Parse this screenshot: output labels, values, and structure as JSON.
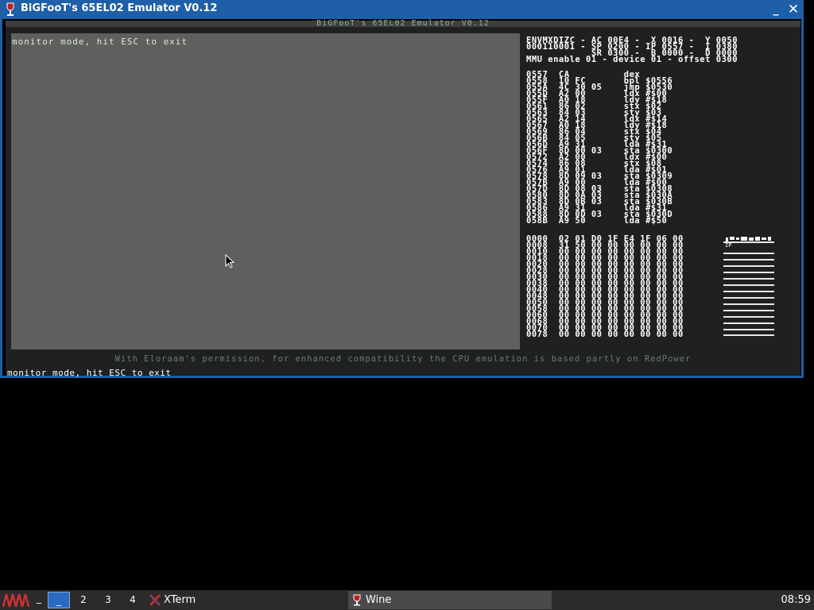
{
  "window": {
    "title": "BiGFooT's 65EL02 Emulator V0.12",
    "minimize_label": "_",
    "close_label": "✕"
  },
  "app": {
    "banner": "BiGFooT's 65EL02 Emulator V0.12",
    "terminal_line": "monitor mode, hit ESC to exit",
    "registers": "ENVMXDIZC - AC 00E4 -  X 0016 -  Y 0050\n000110001 - SP 0200 - IP 0557 -  I 0380\n            SR 0300 -  B 0000 -  D 0000\nMMU enable 01 - device 01 - offset 0300",
    "disassembly": "0557  CA          dex\n0558  10 FC       bpl $0556\n055A  4C 30 05    jmp $0530\n055D  A2 00       ldx #$00\n055F  A0 18       ldy #$18\n0561  86 02       stx $02\n0563  84 03       sty $03\n0565  A2 14       ldx #$14\n0567  A0 18       ldy #$18\n0569  86 04       stx $04\n056B  84 05       sty $05\n056D  A9 31       lda #$31\n056F  8D 00 03    sta $0300\n0572  A2 00       ldx #$00\n0574  86 08       stx $08\n0576  A9 01       lda #$01\n0578  8D 09 03    sta $0309\n057B  A9 00       lda #$00\n057D  8D 08 03    sta $0308\n0580  8D 0A 03    sta $030A\n0583  8D 0B 03    sta $030B\n0586  A9 31       lda #$31\n0588  8D 0D 03    sta $030D\n058B  A9 50       lda #$50",
    "memdump": "0000  02 01 D0 1F E4 1F 06 00\n0008  31 50 00 00 00 00 00 00\n0010  00 00 00 00 00 00 00 00\n0018  00 00 00 00 00 00 00 00\n0020  00 00 00 00 00 00 00 00\n0028  00 00 00 00 00 00 00 00\n0030  00 00 00 00 00 00 00 00\n0038  00 00 00 00 00 00 00 00\n0040  00 00 00 00 00 00 00 00\n0048  00 00 00 00 00 00 00 00\n0050  00 00 00 00 00 00 00 00\n0058  00 00 00 00 00 00 00 00\n0060  00 00 00 00 00 00 00 00\n0068  00 00 00 00 00 00 00 00\n0070  00 00 00 00 00 00 00 00\n0078  00 00 00 00 00 00 00 00",
    "credits": "With Eloraam's permission, for enhanced compatibility the CPU emulation is based partly on RedPower",
    "status_line": "monitor mode, hit ESC to exit"
  },
  "taskbar": {
    "desktops": [
      "_",
      "2",
      "3",
      "4"
    ],
    "tasks": [
      {
        "label": "XTerm",
        "icon": "xterm-icon"
      },
      {
        "label": "Wine",
        "icon": "wine-icon"
      }
    ],
    "clock": "08:59"
  },
  "colors": {
    "title_bar": "#1e5fa7",
    "terminal_bg": "#5f5f5d",
    "screen_bg": "#1e2120",
    "taskbar_bg": "#2b2b2b",
    "active_desktop": "#2a6ac0"
  }
}
